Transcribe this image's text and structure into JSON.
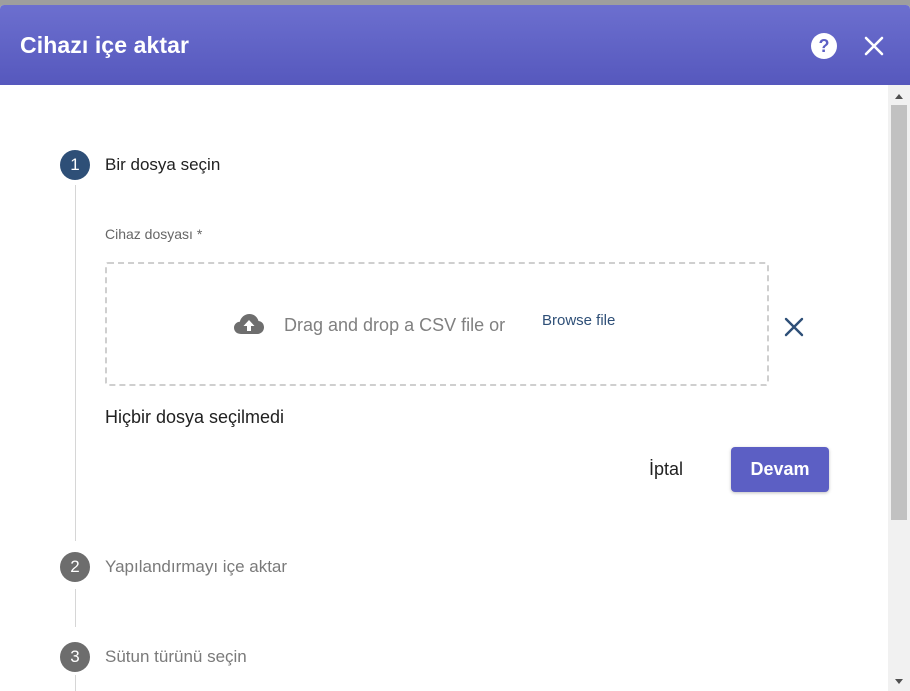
{
  "dialog": {
    "title": "Cihazı içe aktar",
    "help_icon": "help-circle-icon",
    "close_icon": "close-icon"
  },
  "steps": [
    {
      "number": "1",
      "label": "Bir dosya seçin",
      "state": "active"
    },
    {
      "number": "2",
      "label": "Yapılandırmayı içe aktar",
      "state": "inactive"
    },
    {
      "number": "3",
      "label": "Sütun türünü seçin",
      "state": "inactive"
    }
  ],
  "file_step": {
    "field_label": "Cihaz dosyası *",
    "drop_text": "Drag and drop a CSV file or",
    "browse_label": "Browse file",
    "upload_icon": "cloud-upload-icon",
    "clear_icon": "close-icon",
    "no_file_text": "Hiçbir dosya seçilmedi",
    "cancel_label": "İptal",
    "continue_label": "Devam"
  },
  "colors": {
    "header": "#5c5fc4",
    "active_step": "#2e4f77",
    "inactive_step": "#6d6d6d",
    "primary_button": "#5c5fc4"
  }
}
